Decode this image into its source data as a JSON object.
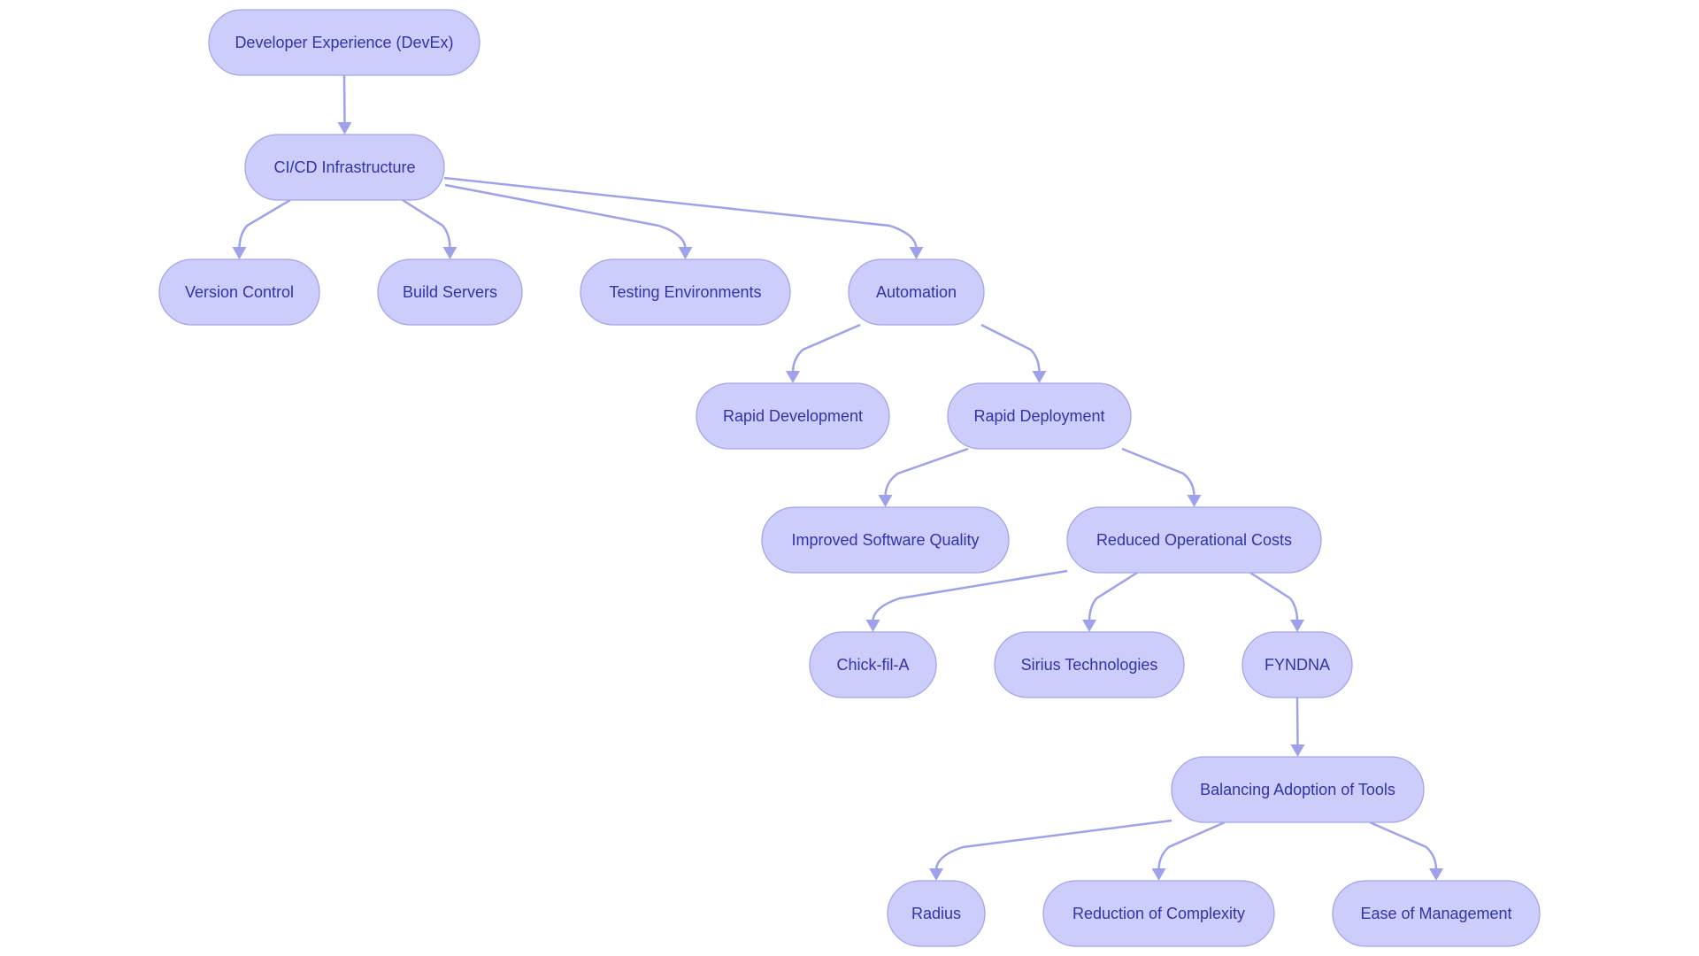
{
  "diagram": {
    "type": "flowchart-tree",
    "colors": {
      "node_fill": "#cccdfb",
      "node_stroke": "#a2a6e8",
      "edge": "#9ea2ea",
      "text": "#3133a8",
      "background": "#ffffff"
    },
    "nodes": [
      {
        "id": "devex",
        "label": "Developer Experience (DevEx)"
      },
      {
        "id": "cicd",
        "label": "CI/CD Infrastructure"
      },
      {
        "id": "version_control",
        "label": "Version Control"
      },
      {
        "id": "build_servers",
        "label": "Build Servers"
      },
      {
        "id": "testing_env",
        "label": "Testing Environments"
      },
      {
        "id": "automation",
        "label": "Automation"
      },
      {
        "id": "rapid_dev",
        "label": "Rapid Development"
      },
      {
        "id": "rapid_deploy",
        "label": "Rapid Deployment"
      },
      {
        "id": "improved_quality",
        "label": "Improved Software Quality"
      },
      {
        "id": "reduced_costs",
        "label": "Reduced Operational Costs"
      },
      {
        "id": "chick_fil_a",
        "label": "Chick-fil-A"
      },
      {
        "id": "sirius",
        "label": "Sirius Technologies"
      },
      {
        "id": "fyndna",
        "label": "FYNDNA"
      },
      {
        "id": "balancing",
        "label": "Balancing Adoption of Tools"
      },
      {
        "id": "radius",
        "label": "Radius"
      },
      {
        "id": "reduction_complexity",
        "label": "Reduction of Complexity"
      },
      {
        "id": "ease_management",
        "label": "Ease of Management"
      }
    ],
    "edges": [
      {
        "from": "devex",
        "to": "cicd"
      },
      {
        "from": "cicd",
        "to": "version_control"
      },
      {
        "from": "cicd",
        "to": "build_servers"
      },
      {
        "from": "cicd",
        "to": "testing_env"
      },
      {
        "from": "cicd",
        "to": "automation"
      },
      {
        "from": "automation",
        "to": "rapid_dev"
      },
      {
        "from": "automation",
        "to": "rapid_deploy"
      },
      {
        "from": "rapid_deploy",
        "to": "improved_quality"
      },
      {
        "from": "rapid_deploy",
        "to": "reduced_costs"
      },
      {
        "from": "reduced_costs",
        "to": "chick_fil_a"
      },
      {
        "from": "reduced_costs",
        "to": "sirius"
      },
      {
        "from": "reduced_costs",
        "to": "fyndna"
      },
      {
        "from": "fyndna",
        "to": "balancing"
      },
      {
        "from": "balancing",
        "to": "radius"
      },
      {
        "from": "balancing",
        "to": "reduction_complexity"
      },
      {
        "from": "balancing",
        "to": "ease_management"
      }
    ]
  }
}
